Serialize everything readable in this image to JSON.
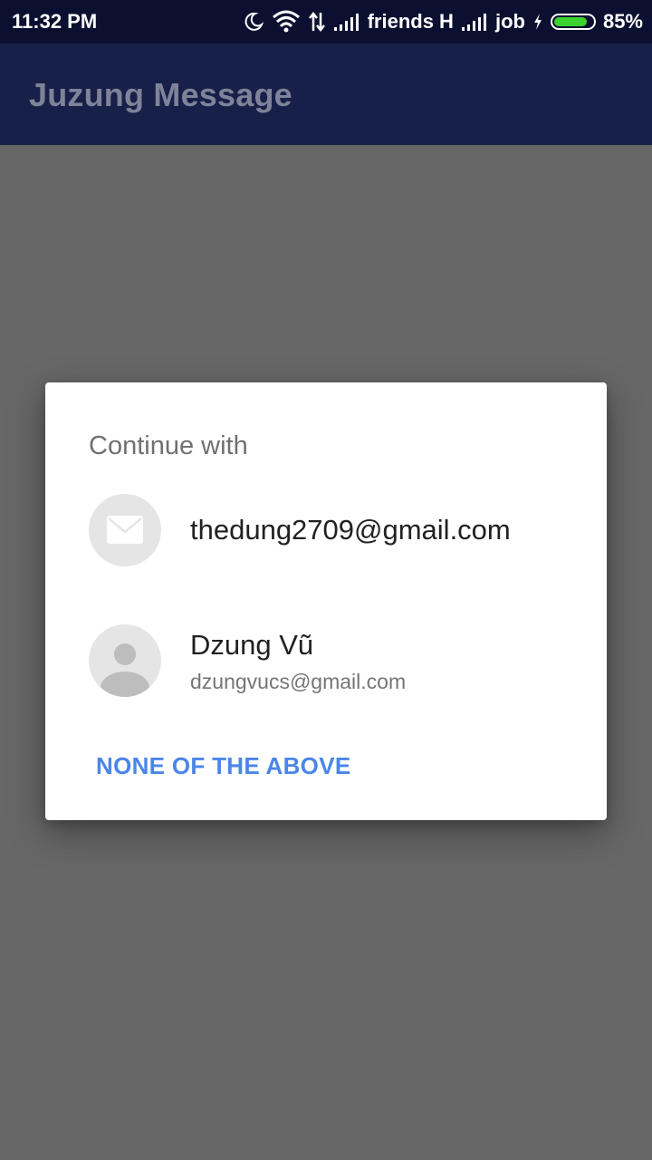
{
  "status_bar": {
    "time": "11:32 PM",
    "carrier_1": "friends H",
    "carrier_2": "job",
    "battery_percent": "85%",
    "battery_level": 0.85,
    "icons": [
      "moon-icon",
      "wifi-icon",
      "data-transfer-icon",
      "signal-icon",
      "signal-icon",
      "charging-icon",
      "battery-icon"
    ]
  },
  "app_bar": {
    "title": "Juzung Message"
  },
  "dialog": {
    "title": "Continue with",
    "accounts": [
      {
        "email": "thedung2709@gmail.com",
        "avatar_icon": "mail-icon"
      },
      {
        "name": "Dzung Vũ",
        "email": "dzungvucs@gmail.com",
        "avatar_icon": "person-icon"
      }
    ],
    "none_button_label": "NONE OF THE ABOVE"
  },
  "colors": {
    "status_bar": "#0c1030",
    "app_bar": "#1a2350",
    "scrim": "#676767",
    "accent": "#4a86e8",
    "battery": "#3bd22e"
  }
}
